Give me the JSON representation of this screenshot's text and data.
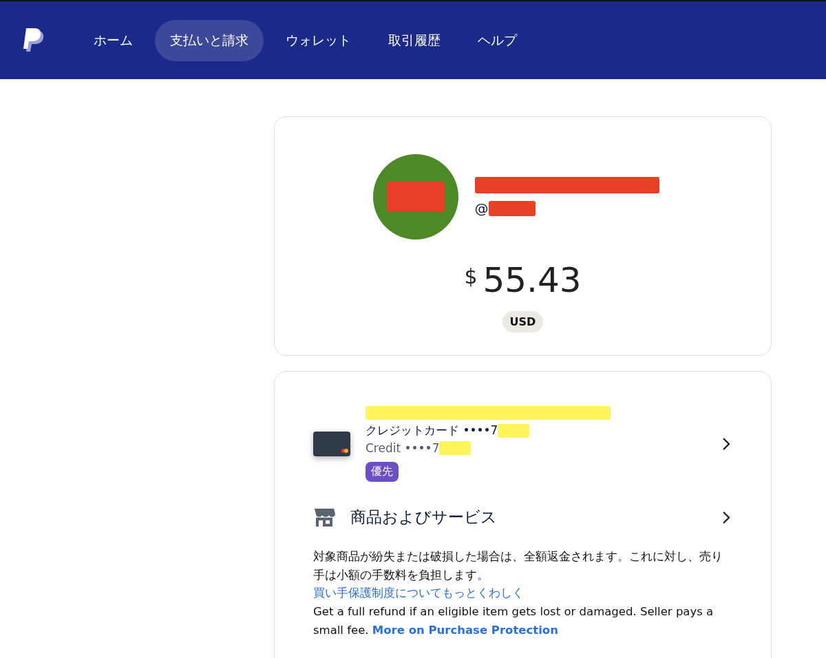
{
  "nav": {
    "items": [
      {
        "label": "ホーム",
        "selected": false
      },
      {
        "label": "支払いと請求",
        "selected": true
      },
      {
        "label": "ウォレット",
        "selected": false
      },
      {
        "label": "取引履歴",
        "selected": false
      },
      {
        "label": "ヘルプ",
        "selected": false
      }
    ]
  },
  "profile": {
    "handle_prefix": "@",
    "balance": {
      "currency_symbol": "$",
      "amount": "55.43",
      "currency": "USD"
    }
  },
  "payment_method": {
    "label_jp": "クレジットカード ••••7",
    "label_en": "Credit ••••7",
    "badge": "優先"
  },
  "protection": {
    "title": "商品およびサービス",
    "description_jp": "対象商品が紛失または破損した場合は、全額返金されます。これに対し、売り手は小額の手数料を負担します。",
    "link_jp": "買い手保護制度についてもっとくわしく",
    "description_en": "Get a full refund if an eligible item gets lost or damaged. Seller pays a small fee.",
    "link_en": "More on Purchase Protection"
  }
}
